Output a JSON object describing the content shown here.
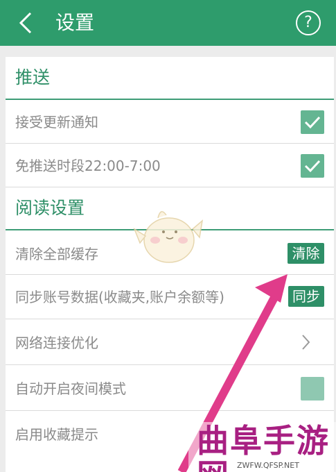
{
  "header": {
    "title": "设置",
    "back_icon": "chevron-left-icon",
    "help_symbol": "?"
  },
  "colors": {
    "brand_green": "#2e9c6c",
    "accent_green": "#2e8f67",
    "checkbox_checked": "#64b592",
    "checkbox_unchecked": "#8fc8b1",
    "annotation_arrow": "#e03c8a",
    "watermark": "#a82082"
  },
  "sections": {
    "push": {
      "title": "推送",
      "items": [
        {
          "label": "接受更新通知",
          "checked": true
        },
        {
          "label": "免推送时段22:00-7:00",
          "checked": true
        }
      ]
    },
    "reading": {
      "title": "阅读设置",
      "items": [
        {
          "label": "清除全部缓存",
          "button": "清除"
        },
        {
          "label": "同步账号数据(收藏夹,账户余额等)",
          "button": "同步"
        },
        {
          "label": "网络连接优化",
          "control": "chevron-right-icon"
        },
        {
          "label": "自动开启夜间模式",
          "checked": false
        },
        {
          "label": "启用收藏提示"
        }
      ]
    }
  },
  "watermark": {
    "text": "曲阜手游网",
    "url": "ZWFW.QFSP.NET"
  }
}
